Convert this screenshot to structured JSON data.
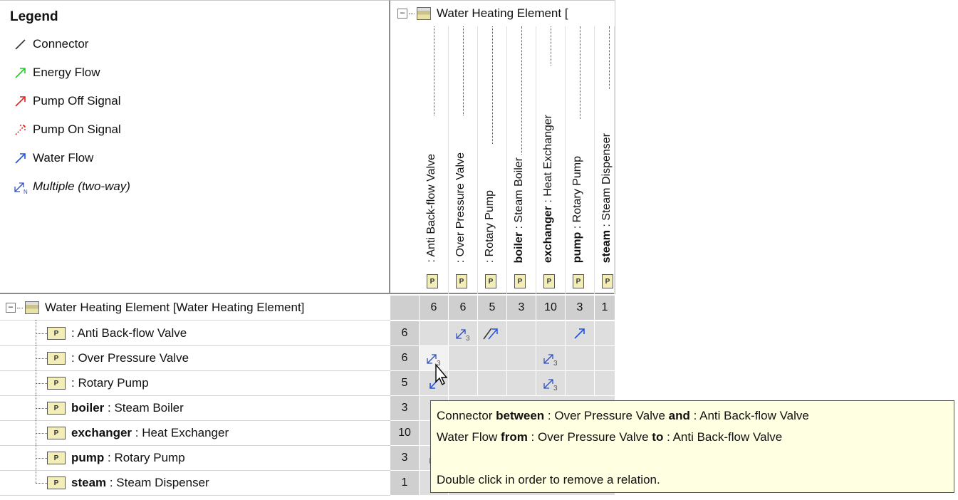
{
  "legend": {
    "title": "Legend",
    "items": [
      {
        "label": "Connector",
        "color": "#333333",
        "icon": "connector-line-icon"
      },
      {
        "label": "Energy Flow",
        "color": "#22cc22",
        "icon": "energy-flow-arrow-icon"
      },
      {
        "label": "Pump Off Signal",
        "color": "#e02020",
        "icon": "pump-off-arrow-icon"
      },
      {
        "label": "Pump On Signal",
        "color": "#e02020",
        "icon": "pump-on-dashed-arrow-icon"
      },
      {
        "label": "Water Flow",
        "color": "#2050e0",
        "icon": "water-flow-arrow-icon"
      },
      {
        "label": "Multiple (two-way)",
        "color": "#3050c0",
        "icon": "multiple-two-way-icon"
      }
    ]
  },
  "columns": {
    "root_label": "Water Heating Element [",
    "items": [
      {
        "name": "",
        "type": ": Anti Back-flow Valve",
        "count": "6"
      },
      {
        "name": "",
        "type": ": Over Pressure Valve",
        "count": "6"
      },
      {
        "name": "",
        "type": ": Rotary Pump",
        "count": "5"
      },
      {
        "name": "boiler",
        "type": " : Steam Boiler",
        "count": "3"
      },
      {
        "name": "exchanger",
        "type": " : Heat Exchanger",
        "count": "10"
      },
      {
        "name": "pump",
        "type": " : Rotary Pump",
        "count": "3"
      },
      {
        "name": "steam",
        "type": " : Steam Dispenser",
        "count": "1"
      }
    ],
    "part_tag": "P"
  },
  "rows": {
    "root_label": "Water Heating Element [Water Heating Element]",
    "items": [
      {
        "name": "",
        "type": ": Anti Back-flow Valve",
        "count": "6"
      },
      {
        "name": "",
        "type": ": Over Pressure Valve",
        "count": "6"
      },
      {
        "name": "",
        "type": ": Rotary Pump",
        "count": "5"
      },
      {
        "name": "boiler",
        "type": " : Steam Boiler",
        "count": "3"
      },
      {
        "name": "exchanger",
        "type": " : Heat Exchanger",
        "count": "10"
      },
      {
        "name": "pump",
        "type": " : Rotary Pump",
        "count": "3"
      },
      {
        "name": "steam",
        "type": " : Steam Dispenser",
        "count": "1"
      }
    ],
    "part_tag": "P"
  },
  "cell_labels": {
    "multi_count": "3"
  },
  "tooltip": {
    "line1_a": "Connector",
    "line1_b": "between",
    "line1_c": " : Over Pressure Valve ",
    "line1_d": "and",
    "line1_e": " : Anti Back-flow Valve",
    "line2_a": "Water Flow ",
    "line2_b": "from",
    "line2_c": " : Over Pressure Valve ",
    "line2_d": "to",
    "line2_e": " : Anti Back-flow Valve",
    "line3": "Double click in order to remove a relation."
  }
}
